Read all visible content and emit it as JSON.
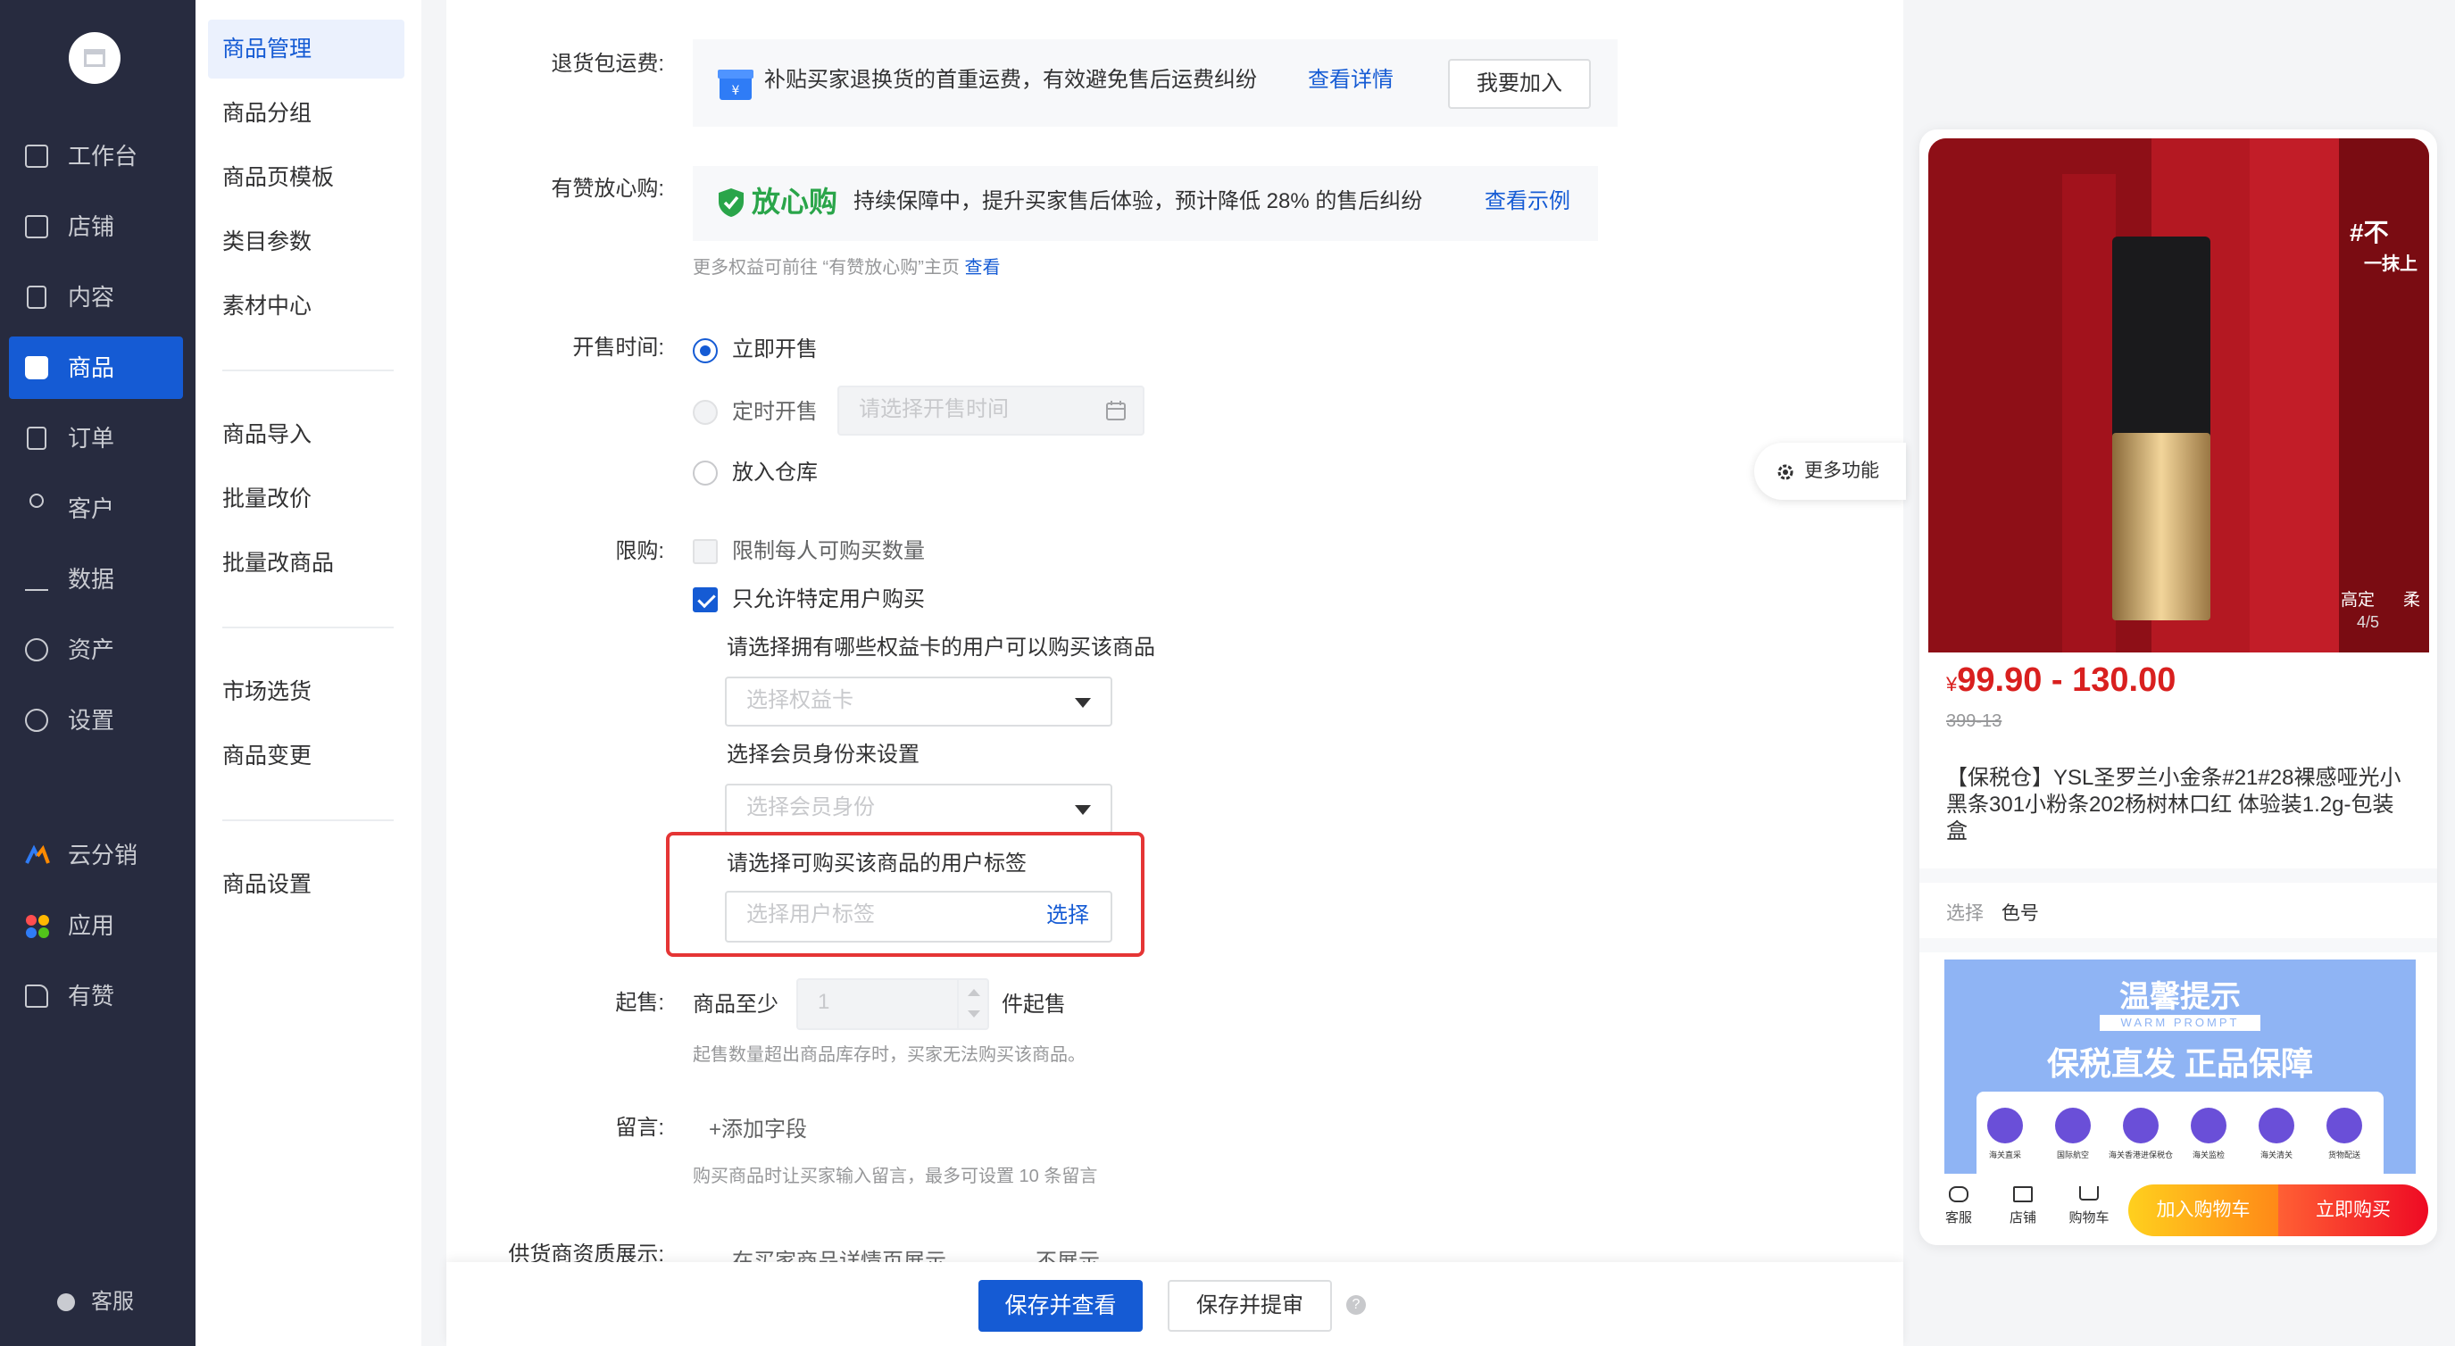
{
  "nav": {
    "items": [
      {
        "label": "工作台",
        "icon": "chat-board-icon"
      },
      {
        "label": "店铺",
        "icon": "shop-icon"
      },
      {
        "label": "内容",
        "icon": "document-icon"
      },
      {
        "label": "商品",
        "icon": "bag-icon",
        "active": true
      },
      {
        "label": "订单",
        "icon": "list-icon"
      },
      {
        "label": "客户",
        "icon": "user-icon"
      },
      {
        "label": "数据",
        "icon": "bar-chart-icon"
      },
      {
        "label": "资产",
        "icon": "yen-icon"
      },
      {
        "label": "设置",
        "icon": "gear-icon"
      },
      {
        "label": "云分销",
        "icon": "cloud-icon"
      },
      {
        "label": "应用",
        "icon": "apps-icon"
      },
      {
        "label": "有赞",
        "icon": "thumb-up-icon"
      }
    ],
    "kefu": "客服"
  },
  "subnav": {
    "items": [
      "商品管理",
      "商品分组",
      "商品页模板",
      "类目参数",
      "素材中心",
      "商品导入",
      "批量改价",
      "批量改商品",
      "市场选货",
      "商品变更",
      "商品设置"
    ]
  },
  "form": {
    "return_shipping": {
      "label": "退货包运费:",
      "desc": "补贴买家退换货的首重运费，有效避免售后运费纠纷",
      "link": "查看详情",
      "button": "我要加入"
    },
    "worry_free": {
      "label": "有赞放心购:",
      "brand": "放心购",
      "desc": "持续保障中，提升买家售后体验，预计降低 28% 的售后纠纷",
      "link": "查看示例",
      "hint": "更多权益可前往 “有赞放心购”主页",
      "hint_link": "查看"
    },
    "sale_time": {
      "label": "开售时间:",
      "options": [
        "立即开售",
        "定时开售",
        "放入仓库"
      ],
      "selected": "立即开售",
      "time_placeholder": "请选择开售时间"
    },
    "limit": {
      "label": "限购:",
      "per_person": "限制每人可购买数量",
      "specific_users": "只允许特定用户购买",
      "card_prompt": "请选择拥有哪些权益卡的用户可以购买该商品",
      "card_placeholder": "选择权益卡",
      "member_prompt": "选择会员身份来设置",
      "member_placeholder": "选择会员身份",
      "tag_prompt": "请选择可购买该商品的用户标签",
      "tag_placeholder": "选择用户标签",
      "tag_button": "选择"
    },
    "min_sale": {
      "label": "起售:",
      "prefix": "商品至少",
      "value": "1",
      "suffix": "件起售",
      "hint": "起售数量超出商品库存时，买家无法购买该商品。"
    },
    "message": {
      "label": "留言:",
      "add": "+添加字段",
      "hint": "购买商品时让买家输入留言，最多可设置 10 条留言"
    },
    "supplier": {
      "label": "供货商资质展示:",
      "option1": "在买家商品详情页展示",
      "option2": "不展示"
    }
  },
  "more_functions": "更多功能",
  "actions": {
    "save_view": "保存并查看",
    "save_review": "保存并提审",
    "help": "?"
  },
  "preview": {
    "photo_overlay": [
      "#不",
      "一抹上",
      "高定",
      "柔",
      "4/5"
    ],
    "price": "99.90 - 130.00",
    "currency": "¥",
    "original_price": "399-13",
    "title": "【保税仓】YSL圣罗兰小金条#21#28裸感哑光小黑条301小粉条202杨树林口红 体验装1.2g-包装盒",
    "select_label": "选择",
    "select_value": "色号",
    "banner": {
      "title": "温馨提示",
      "subtitle": "WARM PROMPT",
      "headline": "保税直发 正品保障",
      "steps": [
        "海关直采",
        "国际航空",
        "海关香港进保税仓",
        "海关监检",
        "海关清关",
        "货物配送"
      ]
    },
    "bottom": {
      "icons": [
        {
          "label": "客服",
          "icon": "chat-icon"
        },
        {
          "label": "店铺",
          "icon": "shop-icon"
        },
        {
          "label": "购物车",
          "icon": "cart-icon"
        }
      ],
      "add_cart": "加入购物车",
      "buy_now": "立即购买"
    }
  },
  "colors": {
    "primary": "#155bd4",
    "nav_bg": "#272b3f",
    "danger": "#d9201f",
    "highlight": "#e53535"
  }
}
